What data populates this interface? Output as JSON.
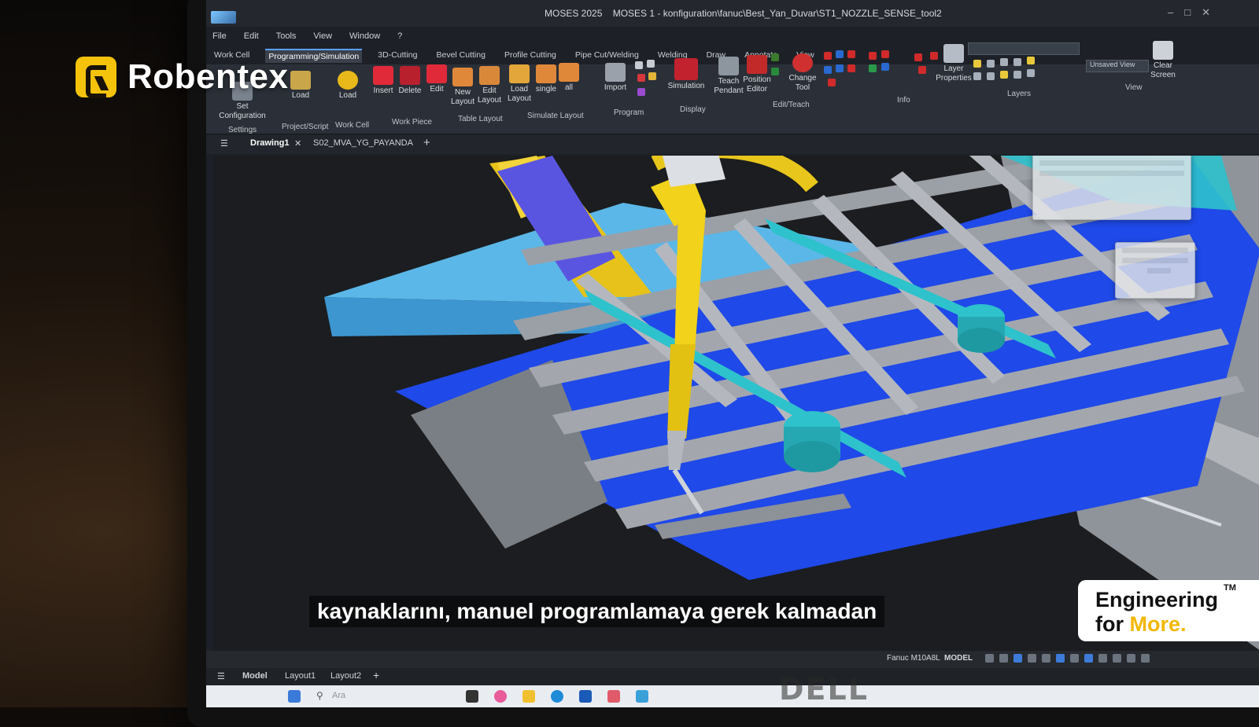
{
  "window": {
    "app_name": "MOSES 2025",
    "document_path": "MOSES 1 - konfiguration\\fanuc\\Best_Yan_Duvar\\ST1_NOZZLE_SENSE_tool2"
  },
  "menu": [
    "File",
    "Edit",
    "Tools",
    "View",
    "Window",
    "?"
  ],
  "ribbon_tabs": [
    "Work Cell",
    "Programming/Simulation",
    "3D-Cutting",
    "Bevel Cutting",
    "Profile Cutting",
    "Pipe Cut/Welding",
    "Welding",
    "Draw",
    "Annotate",
    "View"
  ],
  "active_ribbon_tab": "Programming/Simulation",
  "ribbon": {
    "buttons": {
      "set_configuration": "Set Configuration",
      "load_script": "Load",
      "load_workcell": "Load",
      "insert": "Insert",
      "delete": "Delete",
      "edit": "Edit",
      "new_layout": "New Layout",
      "edit_layout": "Edit Layout",
      "load_layout": "Load Layout",
      "single": "single",
      "all": "all",
      "import": "Import",
      "simulation": "Simulation",
      "teach_pendant": "Teach Pendant",
      "position_editor": "Position Editor",
      "change_tool": "Change Tool",
      "layer_properties": "Layer Properties",
      "clear_screen": "Clear Screen"
    },
    "groups": {
      "settings": "Settings",
      "project_script": "Project/Script",
      "work_cell": "Work Cell",
      "work_piece": "Work Piece",
      "table_layout": "Table Layout",
      "simulate_layout": "Simulate Layout",
      "program": "Program",
      "display": "Display",
      "edit_teach": "Edit/Teach",
      "info": "Info",
      "layers": "Layers",
      "view": "View"
    },
    "view_dropdown": "Unsaved View"
  },
  "doc_tabs": [
    "Drawing1",
    "S02_MVA_YG_PAYANDA"
  ],
  "status": {
    "robot": "Fanuc M10A8L",
    "space": "MODEL"
  },
  "layout_tabs": [
    "Model",
    "Layout1",
    "Layout2"
  ],
  "taskbar": {
    "search_placeholder": "Ara"
  },
  "overlay": {
    "brand": "Robentex",
    "subtitle": "kaynaklarını, manuel programlamaya gerek kalmadan",
    "tagline_line1": "Engineering",
    "tagline_line2_prefix": "for ",
    "tagline_line2_accent": "More.",
    "trademark": "TM",
    "laptop_brand": "DELL"
  },
  "colors": {
    "brand_yellow": "#f5c20c",
    "accent_blue": "#3d7bd8",
    "robot_yellow": "#f2d21a",
    "table_blue": "#1f49e8",
    "fixture_cyan": "#2ec2cc"
  }
}
